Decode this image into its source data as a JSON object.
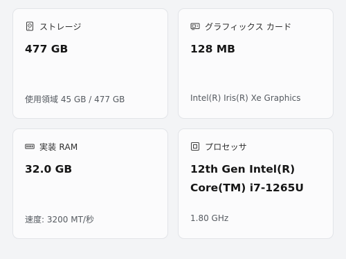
{
  "cards": [
    {
      "title": "ストレージ",
      "icon": "storage-drive-icon",
      "value_lines": [
        "477 GB"
      ],
      "sub": "使用領域 45 GB / 477 GB"
    },
    {
      "title": "グラフィックス カード",
      "icon": "graphics-card-icon",
      "value_lines": [
        "128 MB"
      ],
      "sub": "Intel(R) Iris(R) Xe Graphics"
    },
    {
      "title": "実装 RAM",
      "icon": "memory-ram-icon",
      "value_lines": [
        "32.0 GB"
      ],
      "sub": "速度: 3200 MT/秒"
    },
    {
      "title": "プロセッサ",
      "icon": "processor-chip-icon",
      "value_lines": [
        "12th Gen Intel(R)",
        "Core(TM) i7-1265U"
      ],
      "sub": "1.80 GHz"
    }
  ]
}
